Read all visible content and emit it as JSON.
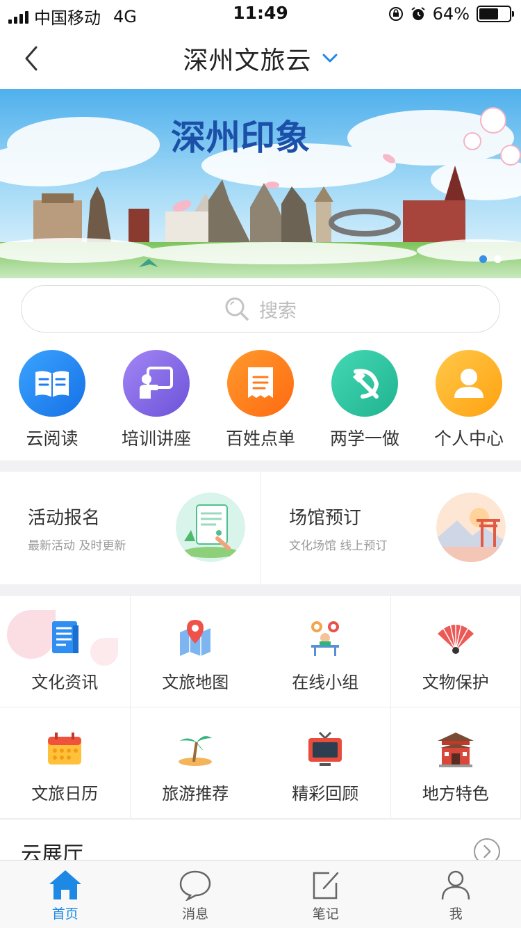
{
  "status_bar": {
    "carrier": "中国移动",
    "network": "4G",
    "time": "11:49",
    "battery": "64%",
    "battery_level": 0.64
  },
  "header": {
    "title": "深州文旅云",
    "back_icon": "chevron-left-icon",
    "dropdown_icon": "chevron-down-icon"
  },
  "banner": {
    "text": "深州印象",
    "slides": 2,
    "active_slide": 1
  },
  "search": {
    "placeholder": "搜索",
    "icon": "search-icon"
  },
  "quick_nav": [
    {
      "label": "云阅读",
      "icon": "book-icon",
      "color": "#1e90ff"
    },
    {
      "label": "培训讲座",
      "icon": "lecture-board-icon",
      "color": "#8a6de9"
    },
    {
      "label": "百姓点单",
      "icon": "receipt-icon",
      "color": "#ff7a1a"
    },
    {
      "label": "两学一做",
      "icon": "hammer-sickle-icon",
      "color": "#2fc8a4"
    },
    {
      "label": "个人中心",
      "icon": "user-icon",
      "color": "#ffb62a"
    }
  ],
  "cards": [
    {
      "title": "活动报名",
      "subtitle": "最新活动 及时更新",
      "icon": "activity-signup-illustration"
    },
    {
      "title": "场馆预订",
      "subtitle": "文化场馆 线上预订",
      "icon": "venue-booking-illustration"
    }
  ],
  "grid": [
    {
      "label": "文化资讯",
      "icon": "news-document-icon"
    },
    {
      "label": "文旅地图",
      "icon": "map-pin-icon"
    },
    {
      "label": "在线小组",
      "icon": "online-group-icon"
    },
    {
      "label": "文物保护",
      "icon": "folding-fan-icon"
    },
    {
      "label": "文旅日历",
      "icon": "calendar-icon"
    },
    {
      "label": "旅游推荐",
      "icon": "palm-island-icon"
    },
    {
      "label": "精彩回顾",
      "icon": "tv-icon"
    },
    {
      "label": "地方特色",
      "icon": "temple-icon"
    }
  ],
  "section": {
    "title": "云展厅",
    "more_icon": "chevron-right-circle-icon"
  },
  "tabbar": [
    {
      "label": "首页",
      "icon": "home-icon",
      "active": true
    },
    {
      "label": "消息",
      "icon": "chat-bubble-icon",
      "active": false
    },
    {
      "label": "笔记",
      "icon": "edit-note-icon",
      "active": false
    },
    {
      "label": "我",
      "icon": "user-outline-icon",
      "active": false
    }
  ],
  "colors": {
    "accent": "#1e88e5",
    "divider": "#f1f1f3"
  }
}
